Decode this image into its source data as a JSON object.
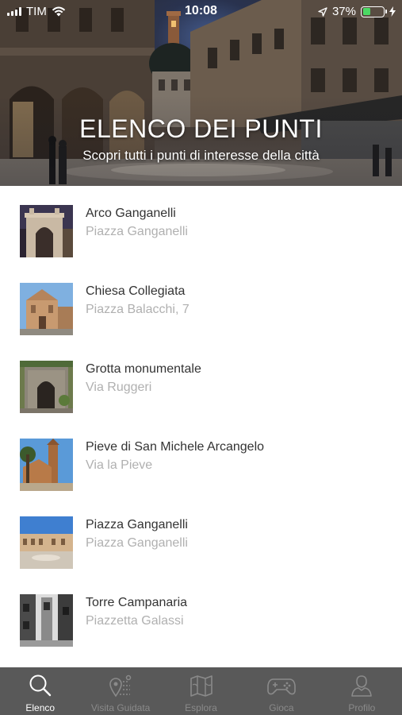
{
  "status_bar": {
    "carrier": "TIM",
    "time": "10:08",
    "battery": "37%",
    "battery_level": 0.37
  },
  "header": {
    "title": "ELENCO DEI PUNTI",
    "subtitle": "Scopri tutti i punti di interesse della città"
  },
  "points": [
    {
      "name": "Arco Ganganelli",
      "address": "Piazza Ganganelli"
    },
    {
      "name": "Chiesa Collegiata",
      "address": "Piazza Balacchi, 7"
    },
    {
      "name": "Grotta monumentale",
      "address": "Via Ruggeri"
    },
    {
      "name": "Pieve di San Michele Arcangelo",
      "address": "Via la Pieve"
    },
    {
      "name": "Piazza Ganganelli",
      "address": "Piazza Ganganelli"
    },
    {
      "name": "Torre Campanaria",
      "address": "Piazzetta Galassi"
    }
  ],
  "tab_bar": {
    "tabs": [
      {
        "label": "Elenco",
        "icon": "search-icon",
        "active": true
      },
      {
        "label": "Visita Guidata",
        "icon": "route-icon",
        "active": false
      },
      {
        "label": "Esplora",
        "icon": "map-icon",
        "active": false
      },
      {
        "label": "Gioca",
        "icon": "gamepad-icon",
        "active": false
      },
      {
        "label": "Profilo",
        "icon": "user-icon",
        "active": false
      }
    ]
  },
  "colors": {
    "tab_bar_bg": "#595959",
    "tab_active": "#ffffff",
    "tab_inactive": "#8a8a8a",
    "text_primary": "#333333",
    "text_secondary": "#b0b0b0",
    "battery_fill": "#4cd964"
  }
}
